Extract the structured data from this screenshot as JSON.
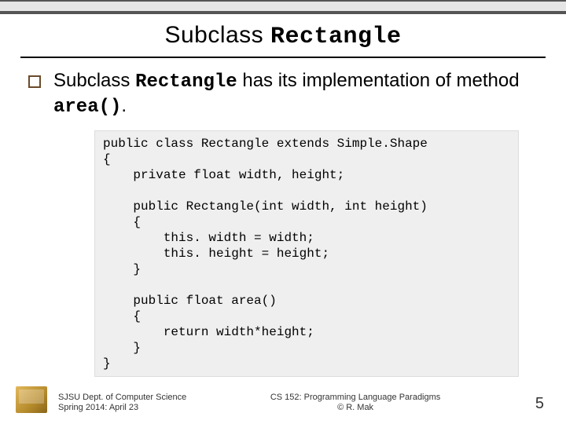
{
  "title": {
    "prefix": "Subclass ",
    "class_name": "Rectangle"
  },
  "bullet": {
    "prefix": "Subclass ",
    "class_name": "Rectangle",
    "mid": " has its implementation of method ",
    "method": "area()",
    "suffix": "."
  },
  "code": "public class Rectangle extends Simple.Shape\n{\n    private float width, height;\n\n    public Rectangle(int width, int height)\n    {\n        this. width = width;\n        this. height = height;\n    }\n\n    public float area()\n    {\n        return width*height;\n    }\n}",
  "footer": {
    "left_line1": "SJSU Dept. of Computer Science",
    "left_line2": "Spring 2014: April 23",
    "center_line1": "CS 152: Programming Language Paradigms",
    "center_line2": "© R. Mak",
    "page": "5"
  }
}
